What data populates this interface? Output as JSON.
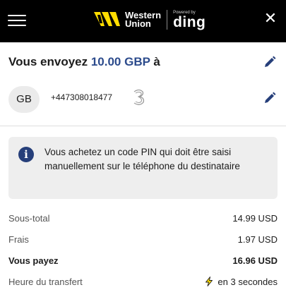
{
  "header": {
    "brand_line1": "Western",
    "brand_line2": "Union",
    "powered_by": "Powered by",
    "partner": "ding",
    "close_glyph": "✕",
    "bg_color": "#000000"
  },
  "send": {
    "prefix": "Vous envoyez ",
    "amount": "10.00 GBP",
    "suffix": " à",
    "amount_color": "#2c4b8c"
  },
  "recipient": {
    "initials": "GB",
    "phone": "+447308018477",
    "operator_icon": "three-operator-logo"
  },
  "info": {
    "text": "Vous achetez un code PIN qui doit être saisi manuellement sur le téléphone du destinataire",
    "icon": "info-icon"
  },
  "summary": {
    "subtotal_label": "Sous-total",
    "subtotal_value": "14.99 USD",
    "fees_label": "Frais",
    "fees_value": "1.97 USD",
    "total_label": "Vous payez",
    "total_value": "16.96 USD",
    "transfer_label": "Heure du transfert",
    "transfer_value": "en 3 secondes"
  }
}
